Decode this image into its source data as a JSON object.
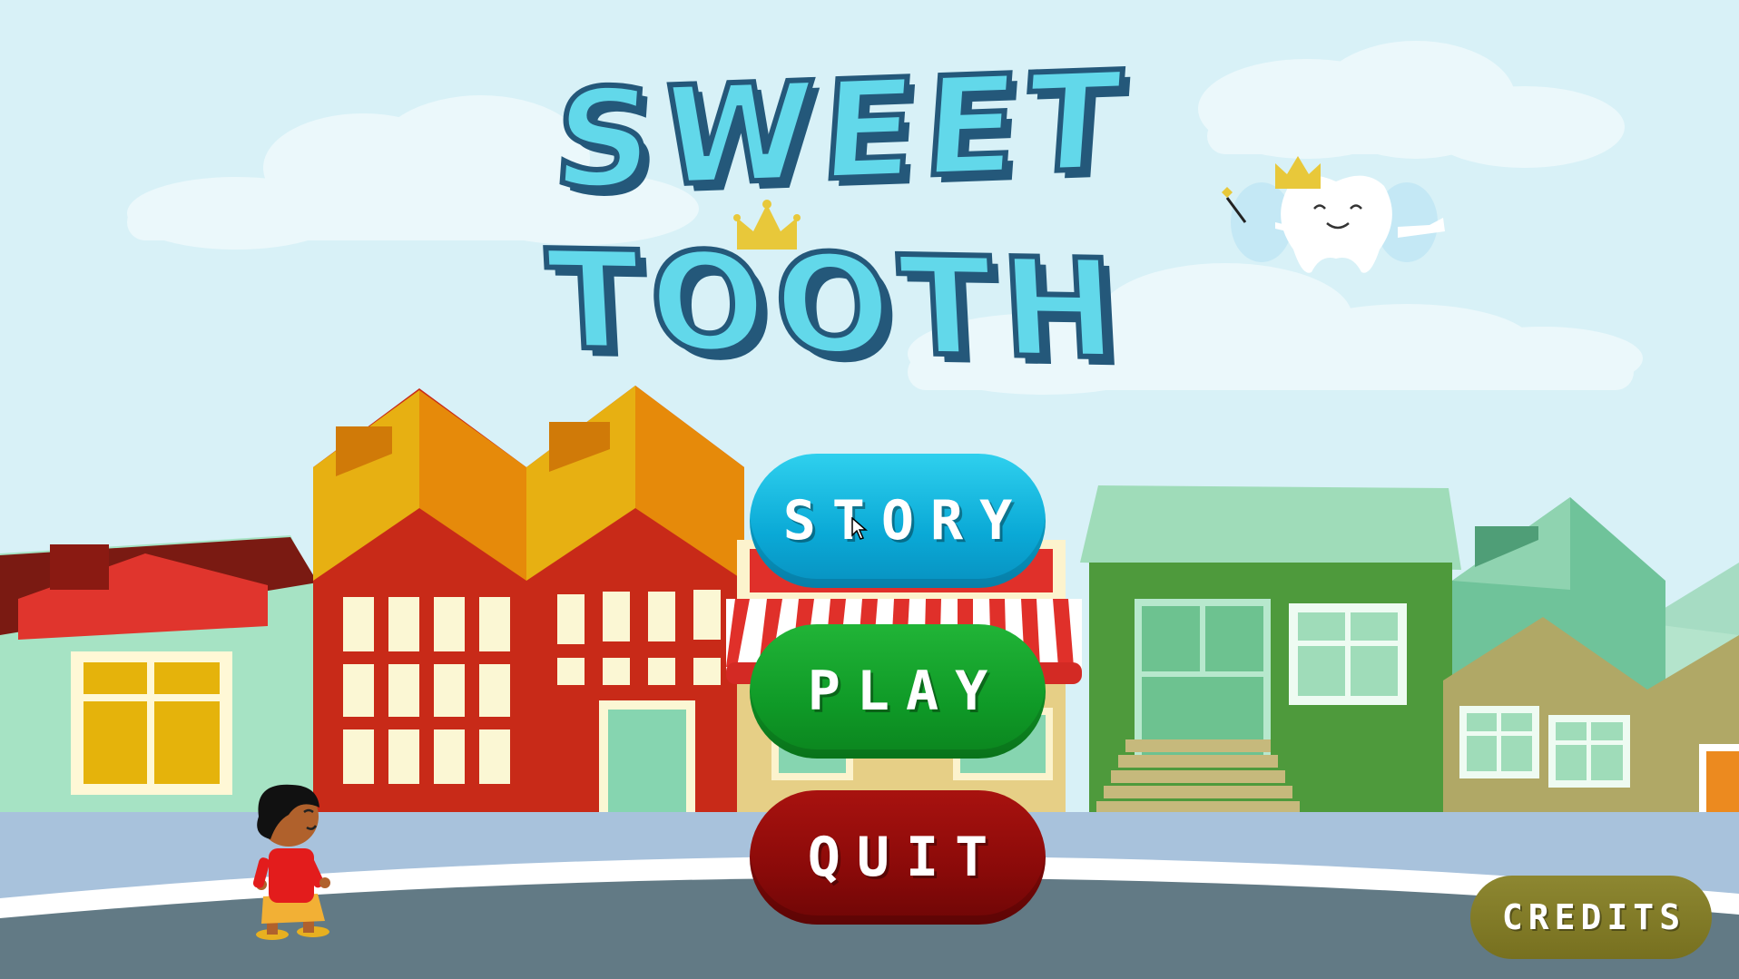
{
  "title": {
    "line1": "SWEET",
    "line2": "TOOTH"
  },
  "menu": {
    "story_label": "STORY",
    "play_label": "PLAY",
    "quit_label": "QUIT",
    "credits_label": "CREDITS"
  },
  "icons": [
    "crown-icon",
    "tooth-fairy-icon",
    "magic-wand-icon",
    "cursor-icon"
  ],
  "colors": {
    "sky": "#d8f1f7",
    "title_fill": "#62d8ea",
    "title_outline": "#24587a",
    "story_button": "#0aa9d6",
    "play_button": "#0f9a27",
    "quit_button": "#8a0a09",
    "credits_button": "#77701f",
    "road": "#627a85",
    "sidewalk": "#a8c2dc"
  }
}
